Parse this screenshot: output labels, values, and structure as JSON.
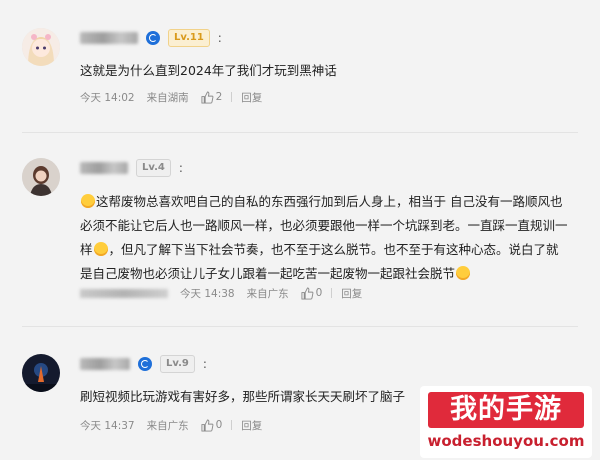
{
  "comments": [
    {
      "level": "Lv.11",
      "colon": ":",
      "text": "这就是为什么直到2024年了我们才玩到黑神话",
      "time": "今天 14:02",
      "location": "来自湖南",
      "likes": "2",
      "reply": "回复"
    },
    {
      "level": "Lv.4",
      "colon": ":",
      "text_parts": [
        "这帮废物总喜欢吧自己的自私的东西强行加到后人身上，相当于 自己没有一路顺风也必须不能让它后人也一路顺风一样，也必须要跟他一样一个坑踩到老。一直踩一直规训一样",
        "，但凡了解下当下社会节奏，也不至于这么脱节。也不至于有这种心态。说白了就是自己废物也必须让儿子女儿跟着一起吃苦一起废物一起跟社会脱节"
      ],
      "time": "今天 14:38",
      "location": "来自广东",
      "likes": "0",
      "reply": "回复"
    },
    {
      "level": "Lv.9",
      "colon": ":",
      "text": "刷短视频比玩游戏有害好多，那些所谓家长天天刷坏了脑子",
      "time": "今天 14:37",
      "location": "来自广东",
      "likes": "0",
      "reply": "回复"
    }
  ],
  "watermark": {
    "title": "我的手游",
    "url": "wodeshouyou.com"
  },
  "colors": {
    "background": "#f3f3f3",
    "badge_blue": "#1e6fd9",
    "level_gold": "#d99a1c",
    "watermark_red": "#e02a3b"
  }
}
